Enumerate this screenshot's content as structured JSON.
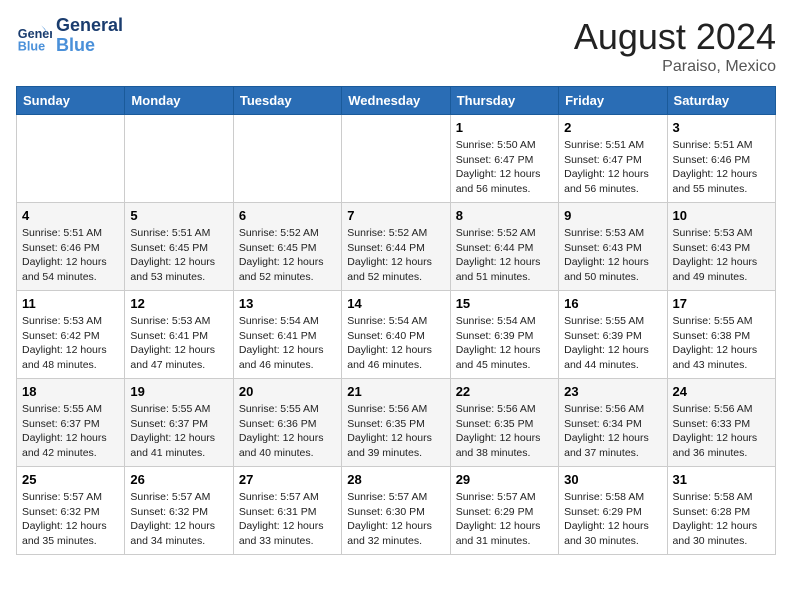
{
  "header": {
    "logo_line1": "General",
    "logo_line2": "Blue",
    "main_title": "August 2024",
    "subtitle": "Paraiso, Mexico"
  },
  "days_of_week": [
    "Sunday",
    "Monday",
    "Tuesday",
    "Wednesday",
    "Thursday",
    "Friday",
    "Saturday"
  ],
  "weeks": [
    {
      "alt": false,
      "days": [
        {
          "num": "",
          "info": ""
        },
        {
          "num": "",
          "info": ""
        },
        {
          "num": "",
          "info": ""
        },
        {
          "num": "",
          "info": ""
        },
        {
          "num": "1",
          "info": "Sunrise: 5:50 AM\nSunset: 6:47 PM\nDaylight: 12 hours\nand 56 minutes."
        },
        {
          "num": "2",
          "info": "Sunrise: 5:51 AM\nSunset: 6:47 PM\nDaylight: 12 hours\nand 56 minutes."
        },
        {
          "num": "3",
          "info": "Sunrise: 5:51 AM\nSunset: 6:46 PM\nDaylight: 12 hours\nand 55 minutes."
        }
      ]
    },
    {
      "alt": true,
      "days": [
        {
          "num": "4",
          "info": "Sunrise: 5:51 AM\nSunset: 6:46 PM\nDaylight: 12 hours\nand 54 minutes."
        },
        {
          "num": "5",
          "info": "Sunrise: 5:51 AM\nSunset: 6:45 PM\nDaylight: 12 hours\nand 53 minutes."
        },
        {
          "num": "6",
          "info": "Sunrise: 5:52 AM\nSunset: 6:45 PM\nDaylight: 12 hours\nand 52 minutes."
        },
        {
          "num": "7",
          "info": "Sunrise: 5:52 AM\nSunset: 6:44 PM\nDaylight: 12 hours\nand 52 minutes."
        },
        {
          "num": "8",
          "info": "Sunrise: 5:52 AM\nSunset: 6:44 PM\nDaylight: 12 hours\nand 51 minutes."
        },
        {
          "num": "9",
          "info": "Sunrise: 5:53 AM\nSunset: 6:43 PM\nDaylight: 12 hours\nand 50 minutes."
        },
        {
          "num": "10",
          "info": "Sunrise: 5:53 AM\nSunset: 6:43 PM\nDaylight: 12 hours\nand 49 minutes."
        }
      ]
    },
    {
      "alt": false,
      "days": [
        {
          "num": "11",
          "info": "Sunrise: 5:53 AM\nSunset: 6:42 PM\nDaylight: 12 hours\nand 48 minutes."
        },
        {
          "num": "12",
          "info": "Sunrise: 5:53 AM\nSunset: 6:41 PM\nDaylight: 12 hours\nand 47 minutes."
        },
        {
          "num": "13",
          "info": "Sunrise: 5:54 AM\nSunset: 6:41 PM\nDaylight: 12 hours\nand 46 minutes."
        },
        {
          "num": "14",
          "info": "Sunrise: 5:54 AM\nSunset: 6:40 PM\nDaylight: 12 hours\nand 46 minutes."
        },
        {
          "num": "15",
          "info": "Sunrise: 5:54 AM\nSunset: 6:39 PM\nDaylight: 12 hours\nand 45 minutes."
        },
        {
          "num": "16",
          "info": "Sunrise: 5:55 AM\nSunset: 6:39 PM\nDaylight: 12 hours\nand 44 minutes."
        },
        {
          "num": "17",
          "info": "Sunrise: 5:55 AM\nSunset: 6:38 PM\nDaylight: 12 hours\nand 43 minutes."
        }
      ]
    },
    {
      "alt": true,
      "days": [
        {
          "num": "18",
          "info": "Sunrise: 5:55 AM\nSunset: 6:37 PM\nDaylight: 12 hours\nand 42 minutes."
        },
        {
          "num": "19",
          "info": "Sunrise: 5:55 AM\nSunset: 6:37 PM\nDaylight: 12 hours\nand 41 minutes."
        },
        {
          "num": "20",
          "info": "Sunrise: 5:55 AM\nSunset: 6:36 PM\nDaylight: 12 hours\nand 40 minutes."
        },
        {
          "num": "21",
          "info": "Sunrise: 5:56 AM\nSunset: 6:35 PM\nDaylight: 12 hours\nand 39 minutes."
        },
        {
          "num": "22",
          "info": "Sunrise: 5:56 AM\nSunset: 6:35 PM\nDaylight: 12 hours\nand 38 minutes."
        },
        {
          "num": "23",
          "info": "Sunrise: 5:56 AM\nSunset: 6:34 PM\nDaylight: 12 hours\nand 37 minutes."
        },
        {
          "num": "24",
          "info": "Sunrise: 5:56 AM\nSunset: 6:33 PM\nDaylight: 12 hours\nand 36 minutes."
        }
      ]
    },
    {
      "alt": false,
      "days": [
        {
          "num": "25",
          "info": "Sunrise: 5:57 AM\nSunset: 6:32 PM\nDaylight: 12 hours\nand 35 minutes."
        },
        {
          "num": "26",
          "info": "Sunrise: 5:57 AM\nSunset: 6:32 PM\nDaylight: 12 hours\nand 34 minutes."
        },
        {
          "num": "27",
          "info": "Sunrise: 5:57 AM\nSunset: 6:31 PM\nDaylight: 12 hours\nand 33 minutes."
        },
        {
          "num": "28",
          "info": "Sunrise: 5:57 AM\nSunset: 6:30 PM\nDaylight: 12 hours\nand 32 minutes."
        },
        {
          "num": "29",
          "info": "Sunrise: 5:57 AM\nSunset: 6:29 PM\nDaylight: 12 hours\nand 31 minutes."
        },
        {
          "num": "30",
          "info": "Sunrise: 5:58 AM\nSunset: 6:29 PM\nDaylight: 12 hours\nand 30 minutes."
        },
        {
          "num": "31",
          "info": "Sunrise: 5:58 AM\nSunset: 6:28 PM\nDaylight: 12 hours\nand 30 minutes."
        }
      ]
    }
  ]
}
